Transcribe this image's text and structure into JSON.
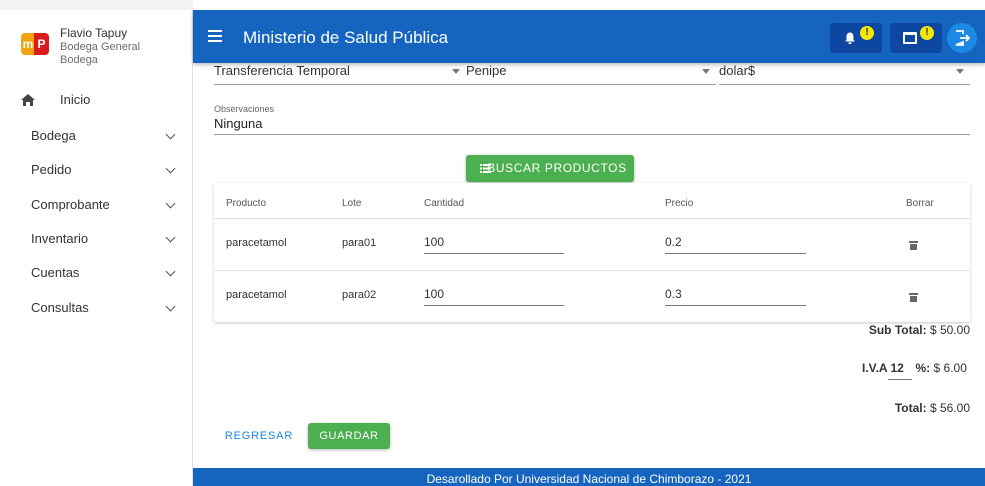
{
  "user": {
    "name": "Flavio Tapuy",
    "role": "Bodega General",
    "area": "Bodega",
    "logo_letters": [
      "m",
      "P"
    ]
  },
  "sidebar": {
    "items": [
      {
        "label": "Inicio",
        "icon": "home-icon"
      },
      {
        "label": "Bodega",
        "icon": "chevron-down-icon"
      },
      {
        "label": "Pedido",
        "icon": "chevron-down-icon"
      },
      {
        "label": "Comprobante",
        "icon": "chevron-down-icon"
      },
      {
        "label": "Inventario",
        "icon": "chevron-down-icon"
      },
      {
        "label": "Cuentas",
        "icon": "chevron-down-icon"
      },
      {
        "label": "Consultas",
        "icon": "chevron-down-icon"
      }
    ]
  },
  "header": {
    "title": "Ministerio de Salud Pública",
    "notification_badge": "!",
    "calendar_badge": "!",
    "colors": {
      "bar": "#1565c0",
      "badge": "#f5e60a"
    }
  },
  "form": {
    "tipo": "Transferencia Temporal",
    "destino": "Penipe",
    "moneda": "dolar$",
    "observaciones_label": "Observaciones",
    "observaciones": "Ninguna",
    "search_button": "BUSCAR PRODUCTOS"
  },
  "table": {
    "headers": [
      "Producto",
      "Lote",
      "Cantidad",
      "Precio",
      "Borrar"
    ],
    "rows": [
      {
        "producto": "paracetamol",
        "lote": "para01",
        "cantidad": "100",
        "precio": "0.2"
      },
      {
        "producto": "paracetamol",
        "lote": "para02",
        "cantidad": "100",
        "precio": "0.3"
      }
    ]
  },
  "totals": {
    "subtotal_label": "Sub Total:",
    "subtotal": "$ 50.00",
    "iva_label": "I.V.A 12",
    "iva_suffix": "%:",
    "iva": "$ 6.00",
    "total_label": "Total:",
    "total": "$ 56.00"
  },
  "actions": {
    "back": "REGRESAR",
    "save": "GUARDAR"
  },
  "footer": {
    "text": "Desarollado Por Universidad Nacional de Chimborazo - 2021"
  }
}
